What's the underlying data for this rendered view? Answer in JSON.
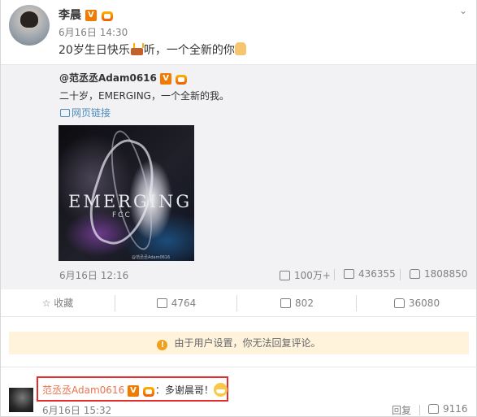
{
  "post": {
    "author": "李晨",
    "time": "6月16日 14:30",
    "text_a": "20岁生日快乐",
    "text_b": "听，一个全新的你",
    "dropdown_icon": "chevron-down-icon"
  },
  "repost": {
    "author": "@范丞丞Adam0616",
    "text": "二十岁，EMERGING，一个全新的我。",
    "link_label": "网页链接",
    "cover_title": "EMERGING",
    "cover_subtitle": "FCC",
    "cover_caption": "@范丞丞Adam0616",
    "time": "6月16日 12:16",
    "stats": {
      "reposts": "100万+",
      "comments": "436355",
      "likes": "1808850"
    }
  },
  "actions": {
    "favorite": "收藏",
    "forward": "4764",
    "comment": "802",
    "like": "36080"
  },
  "notice": {
    "text": "由于用户设置，你无法回复评论。"
  },
  "comment": {
    "author": "范丞丞Adam0616",
    "text": "：多谢晨哥！",
    "time": "6月16日 15:32",
    "reply_label": "回复",
    "likes": "9116"
  },
  "colors": {
    "verified": "#f07b00",
    "link": "#4e8bba",
    "highlight_box": "#e52d2d",
    "notice_bg": "#fff3dc"
  }
}
